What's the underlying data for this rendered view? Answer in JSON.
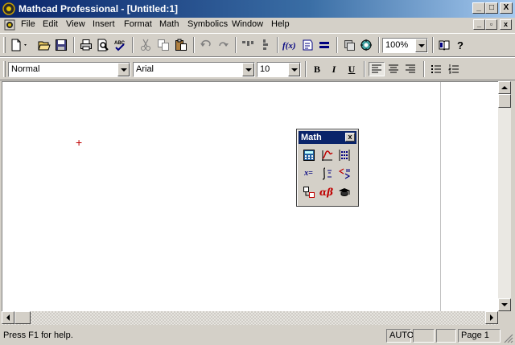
{
  "window": {
    "title": "Mathcad Professional - [Untitled:1]",
    "minimize": "_",
    "maximize": "□",
    "close": "X"
  },
  "menu": {
    "items": [
      "File",
      "Edit",
      "View",
      "Insert",
      "Format",
      "Math",
      "Symbolics",
      "Window",
      "Help"
    ]
  },
  "toolbar": {
    "zoom": "100%"
  },
  "format_bar": {
    "style": "Normal",
    "font": "Arial",
    "size": "10",
    "bold": "B",
    "italic": "I",
    "underline": "U"
  },
  "worksheet": {
    "cursor": "+"
  },
  "math_palette": {
    "title": "Math",
    "close": "x",
    "equals": "x="
  },
  "status": {
    "message": "Press F1 for help.",
    "mode": "AUTO",
    "page": "Page 1"
  },
  "colors": {
    "title_active": "#0a246a",
    "face": "#d4d0c8",
    "cursor": "#c00000"
  }
}
